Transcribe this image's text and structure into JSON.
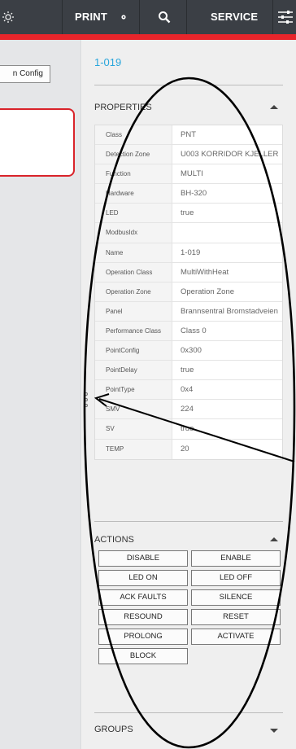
{
  "topbar": {
    "print_label": "PRINT",
    "service_label": "SERVICE",
    "icons": [
      "sun-icon",
      "gear-icon",
      "search-icon",
      "sliders-icon"
    ]
  },
  "left": {
    "config_button_label": "n Config"
  },
  "object": {
    "title": "1-019"
  },
  "properties": {
    "title": "PROPERTIES",
    "rows": [
      {
        "key": "Class",
        "value": "PNT"
      },
      {
        "key": "Detection Zone",
        "value": "U003 KORRIDOR KJELLER"
      },
      {
        "key": "Function",
        "value": "MULTI"
      },
      {
        "key": "Hardware",
        "value": "BH-320"
      },
      {
        "key": "LED",
        "value": "true"
      },
      {
        "key": "ModbusIdx",
        "value": ""
      },
      {
        "key": "Name",
        "value": "1-019"
      },
      {
        "key": "Operation Class",
        "value": "MultiWithHeat"
      },
      {
        "key": "Operation Zone",
        "value": "Operation Zone"
      },
      {
        "key": "Panel",
        "value": "Brannsentral Bromstadveien"
      },
      {
        "key": "Performance Class",
        "value": "Class 0"
      },
      {
        "key": "PointConfig",
        "value": "0x300"
      },
      {
        "key": "PointDelay",
        "value": "true"
      },
      {
        "key": "PointType",
        "value": "0x4"
      },
      {
        "key": "SMV",
        "value": "224"
      },
      {
        "key": "SV",
        "value": "true"
      },
      {
        "key": "TEMP",
        "value": "20"
      }
    ]
  },
  "actions": {
    "title": "ACTIONS",
    "buttons": [
      "DISABLE",
      "ENABLE",
      "LED ON",
      "LED OFF",
      "ACK FAULTS",
      "SILENCE",
      "RESOUND",
      "RESET",
      "PROLONG",
      "ACTIVATE",
      "BLOCK"
    ]
  },
  "groups": {
    "title": "GROUPS"
  },
  "colors": {
    "accent_blue": "#29a6dc",
    "alert_red": "#e8252b",
    "topbar": "#3b3f45"
  }
}
